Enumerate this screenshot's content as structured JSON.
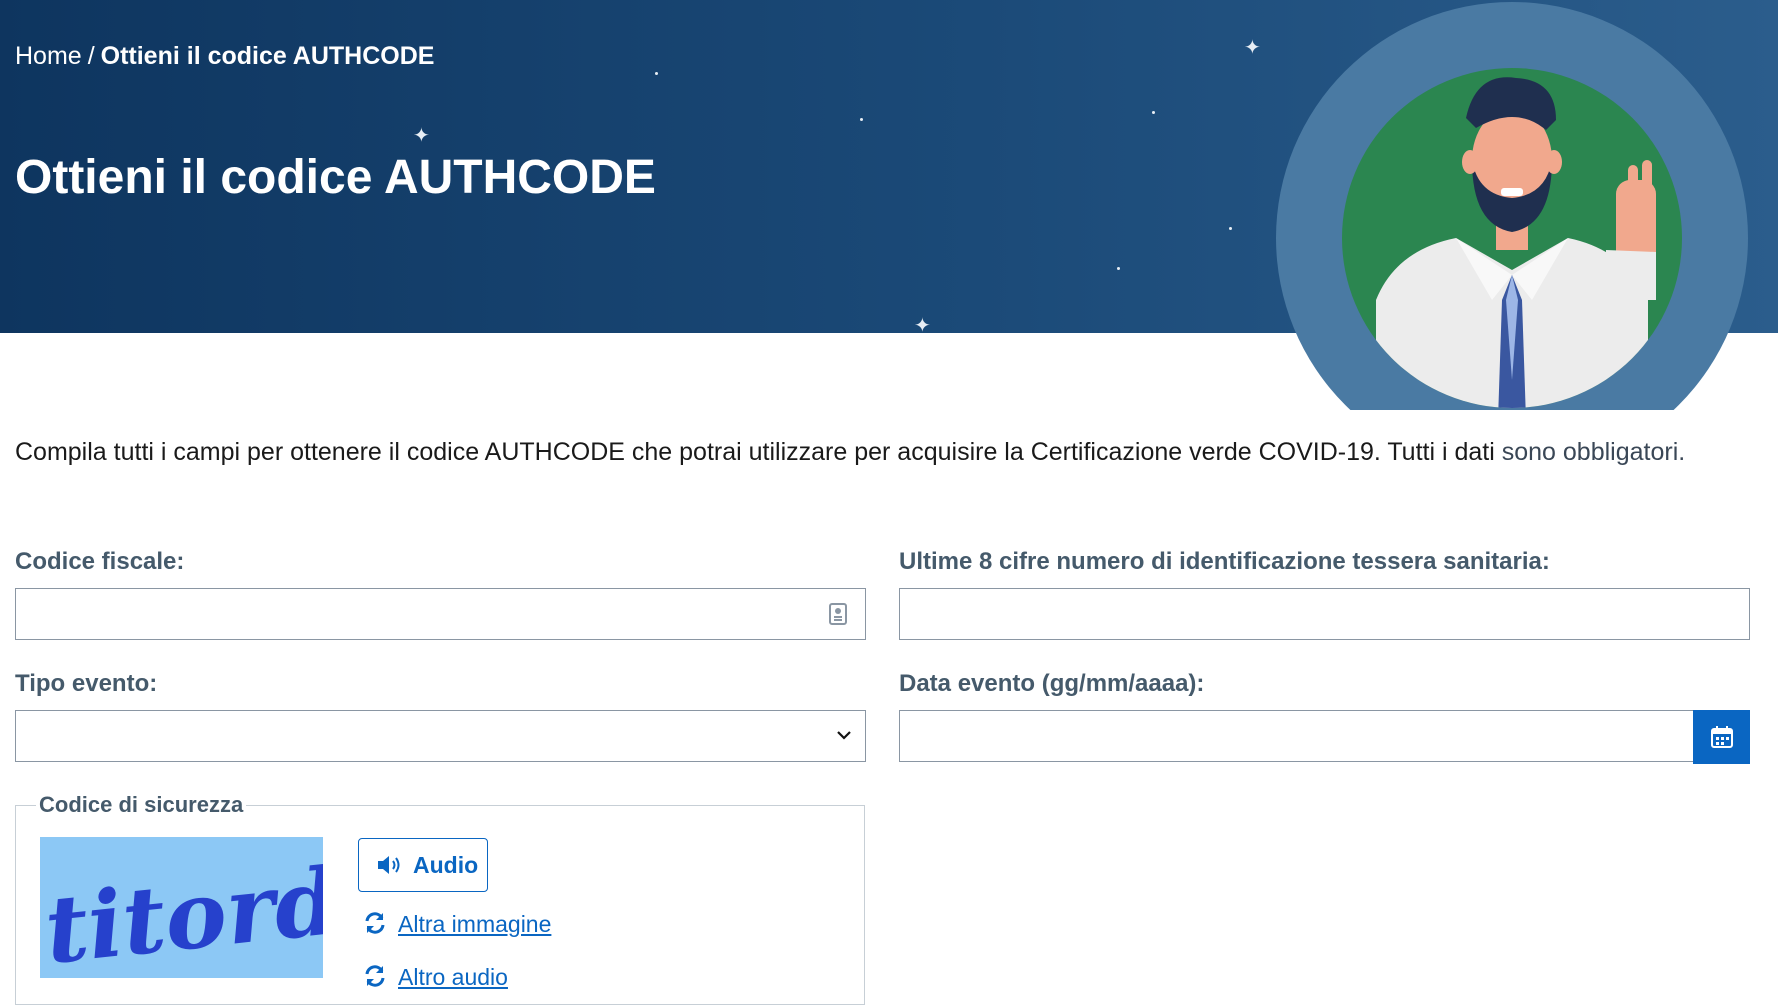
{
  "breadcrumb": {
    "home": "Home",
    "separator": "/",
    "current": "Ottieni il codice AUTHCODE"
  },
  "page_title": "Ottieni il codice AUTHCODE",
  "intro": {
    "text": "Compila tutti i campi per ottenere il codice AUTHCODE che potrai utilizzare per acquisire la Certificazione verde COVID-19. Tutti i dati",
    "emphasis": "sono obbligatori."
  },
  "form": {
    "codice_fiscale": {
      "label": "Codice fiscale:",
      "value": "",
      "icon": "id-card-icon"
    },
    "tessera": {
      "label": "Ultime 8 cifre numero di identificazione tessera sanitaria:",
      "value": ""
    },
    "tipo_evento": {
      "label": "Tipo evento:",
      "selected": "",
      "icon": "chevron-down-icon"
    },
    "data_evento": {
      "label": "Data evento (gg/mm/aaaa):",
      "value": "",
      "icon": "calendar-icon"
    }
  },
  "security": {
    "legend": "Codice di sicurezza",
    "captcha_text": "titordai",
    "audio_button": "Audio",
    "other_image": "Altra immagine",
    "other_audio": "Altro audio"
  },
  "colors": {
    "hero_dark": "#0e355f",
    "hero_light": "#2b5d8c",
    "primary": "#0a66c2",
    "label": "#455a6b",
    "avatar_bg": "#2b8650"
  }
}
